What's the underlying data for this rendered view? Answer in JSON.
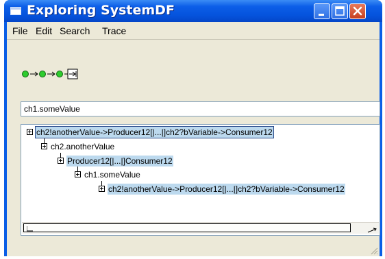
{
  "window": {
    "title": "Exploring SystemDF",
    "colors": {
      "titlebar": "#0553dc",
      "client": "#ece9d8",
      "close": "#c64020",
      "selection": "#bcd9ee"
    }
  },
  "menu": {
    "items": [
      {
        "label": "File"
      },
      {
        "label": "Edit"
      },
      {
        "label": "Search"
      },
      {
        "label": "Trace"
      }
    ]
  },
  "toolbar": {
    "icon": "trace-sequence-icon"
  },
  "path_field": {
    "value": "ch1.someValue"
  },
  "tree": {
    "rows": [
      {
        "label": "ch2!anotherValue->Producer12[|...|]ch2?bVariable->Consumer12",
        "depth": 0,
        "highlighted": true,
        "selected": true
      },
      {
        "label": "ch2.anotherValue",
        "depth": 1,
        "highlighted": false
      },
      {
        "label": "Producer12[|...|]Consumer12",
        "depth": 2,
        "highlighted": true
      },
      {
        "label": "ch1.someValue",
        "depth": 3,
        "highlighted": false
      },
      {
        "label": "ch2!anotherValue->Producer12[|...|]ch2?bVariable->Consumer12",
        "depth": 4,
        "highlighted": true
      }
    ]
  }
}
